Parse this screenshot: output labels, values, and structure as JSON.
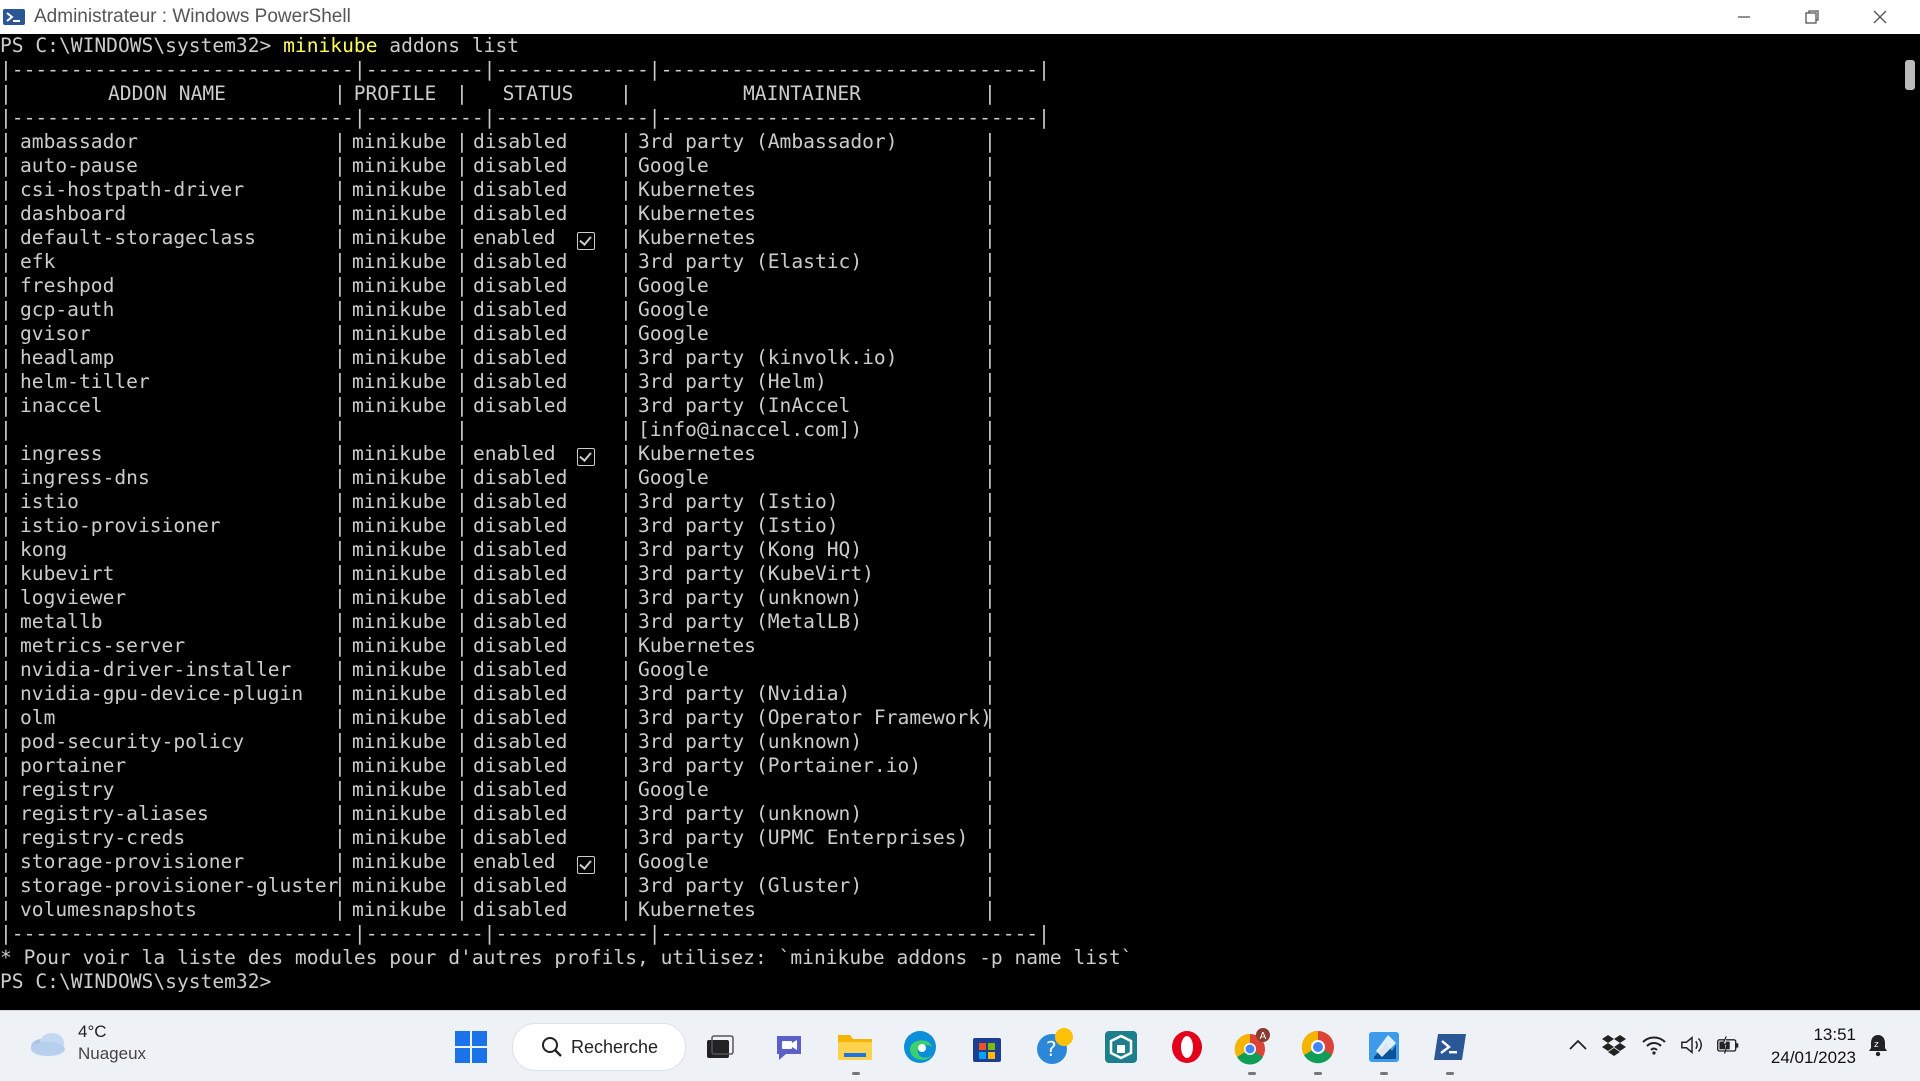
{
  "window": {
    "title": "Administrateur : Windows PowerShell",
    "controls": [
      "minimize",
      "restore",
      "close"
    ]
  },
  "console": {
    "prompt": "PS C:\\WINDOWS\\system32>",
    "command_exe": "minikube",
    "command_args": "addons list",
    "separator": "|-----------------------------|----------|-------------|--------------------------------|",
    "headers": [
      "ADDON NAME",
      "PROFILE",
      "STATUS",
      "MAINTAINER"
    ],
    "rows": [
      {
        "name": "ambassador",
        "profile": "minikube",
        "status": "disabled",
        "maintainer": "3rd party (Ambassador)"
      },
      {
        "name": "auto-pause",
        "profile": "minikube",
        "status": "disabled",
        "maintainer": "Google"
      },
      {
        "name": "csi-hostpath-driver",
        "profile": "minikube",
        "status": "disabled",
        "maintainer": "Kubernetes"
      },
      {
        "name": "dashboard",
        "profile": "minikube",
        "status": "disabled",
        "maintainer": "Kubernetes"
      },
      {
        "name": "default-storageclass",
        "profile": "minikube",
        "status": "enabled",
        "maintainer": "Kubernetes",
        "check": true
      },
      {
        "name": "efk",
        "profile": "minikube",
        "status": "disabled",
        "maintainer": "3rd party (Elastic)"
      },
      {
        "name": "freshpod",
        "profile": "minikube",
        "status": "disabled",
        "maintainer": "Google"
      },
      {
        "name": "gcp-auth",
        "profile": "minikube",
        "status": "disabled",
        "maintainer": "Google"
      },
      {
        "name": "gvisor",
        "profile": "minikube",
        "status": "disabled",
        "maintainer": "Google"
      },
      {
        "name": "headlamp",
        "profile": "minikube",
        "status": "disabled",
        "maintainer": "3rd party (kinvolk.io)"
      },
      {
        "name": "helm-tiller",
        "profile": "minikube",
        "status": "disabled",
        "maintainer": "3rd party (Helm)"
      },
      {
        "name": "inaccel",
        "profile": "minikube",
        "status": "disabled",
        "maintainer": "3rd party (InAccel"
      },
      {
        "name": "",
        "profile": "",
        "status": "",
        "maintainer": "[info@inaccel.com])"
      },
      {
        "name": "ingress",
        "profile": "minikube",
        "status": "enabled",
        "maintainer": "Kubernetes",
        "check": true
      },
      {
        "name": "ingress-dns",
        "profile": "minikube",
        "status": "disabled",
        "maintainer": "Google"
      },
      {
        "name": "istio",
        "profile": "minikube",
        "status": "disabled",
        "maintainer": "3rd party (Istio)"
      },
      {
        "name": "istio-provisioner",
        "profile": "minikube",
        "status": "disabled",
        "maintainer": "3rd party (Istio)"
      },
      {
        "name": "kong",
        "profile": "minikube",
        "status": "disabled",
        "maintainer": "3rd party (Kong HQ)"
      },
      {
        "name": "kubevirt",
        "profile": "minikube",
        "status": "disabled",
        "maintainer": "3rd party (KubeVirt)"
      },
      {
        "name": "logviewer",
        "profile": "minikube",
        "status": "disabled",
        "maintainer": "3rd party (unknown)"
      },
      {
        "name": "metallb",
        "profile": "minikube",
        "status": "disabled",
        "maintainer": "3rd party (MetalLB)"
      },
      {
        "name": "metrics-server",
        "profile": "minikube",
        "status": "disabled",
        "maintainer": "Kubernetes"
      },
      {
        "name": "nvidia-driver-installer",
        "profile": "minikube",
        "status": "disabled",
        "maintainer": "Google"
      },
      {
        "name": "nvidia-gpu-device-plugin",
        "profile": "minikube",
        "status": "disabled",
        "maintainer": "3rd party (Nvidia)"
      },
      {
        "name": "olm",
        "profile": "minikube",
        "status": "disabled",
        "maintainer": "3rd party (Operator Framework)"
      },
      {
        "name": "pod-security-policy",
        "profile": "minikube",
        "status": "disabled",
        "maintainer": "3rd party (unknown)"
      },
      {
        "name": "portainer",
        "profile": "minikube",
        "status": "disabled",
        "maintainer": "3rd party (Portainer.io)"
      },
      {
        "name": "registry",
        "profile": "minikube",
        "status": "disabled",
        "maintainer": "Google"
      },
      {
        "name": "registry-aliases",
        "profile": "minikube",
        "status": "disabled",
        "maintainer": "3rd party (unknown)"
      },
      {
        "name": "registry-creds",
        "profile": "minikube",
        "status": "disabled",
        "maintainer": "3rd party (UPMC Enterprises)"
      },
      {
        "name": "storage-provisioner",
        "profile": "minikube",
        "status": "enabled",
        "maintainer": "Google",
        "check": true
      },
      {
        "name": "storage-provisioner-gluster",
        "profile": "minikube",
        "status": "disabled",
        "maintainer": "3rd party (Gluster)"
      },
      {
        "name": "volumesnapshots",
        "profile": "minikube",
        "status": "disabled",
        "maintainer": "Kubernetes"
      }
    ],
    "footer_note": "* Pour voir la liste des modules pour d'autres profils, utilisez: `minikube addons -p name list`",
    "final_prompt": "PS C:\\WINDOWS\\system32>"
  },
  "taskbar": {
    "weather_temp": "4°C",
    "weather_condition": "Nuageux",
    "search_label": "Recherche",
    "apps": [
      "start-icon",
      "search",
      "file-explorer-icon",
      "teams-chat-icon",
      "folder-icon",
      "edge-icon",
      "store-icon",
      "help-icon",
      "app-icon",
      "opera-icon",
      "chrome-profile-icon",
      "chrome-icon",
      "paint-icon",
      "powershell-icon"
    ],
    "time": "13:51",
    "date": "24/01/2023"
  },
  "colors": {
    "console_bg": "#000000",
    "console_text": "#cccccc",
    "command_highlight": "#ffff55",
    "taskbar_bg": "#eef2f7"
  }
}
